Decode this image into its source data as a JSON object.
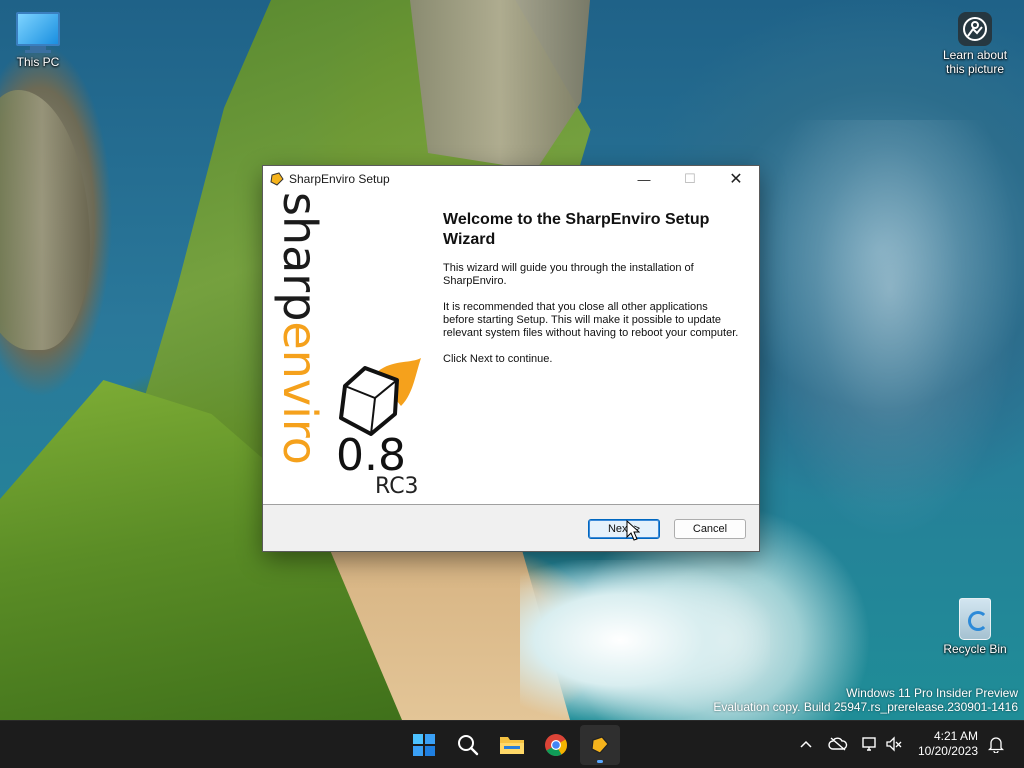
{
  "desktop": {
    "icons": [
      {
        "label": "This PC"
      },
      {
        "label": "Learn about this picture"
      },
      {
        "label": "Recycle Bin"
      }
    ],
    "watermark": {
      "line1": "Windows 11 Pro Insider Preview",
      "line2": "Evaluation copy. Build 25947.rs_prerelease.230901-1416"
    }
  },
  "dialog": {
    "title": "SharpEnviro Setup",
    "window_controls": {
      "minimize": "—",
      "maximize": "☐",
      "close": "✕"
    },
    "banner": {
      "word_dark": "sharp",
      "word_accent": "enviro",
      "version": "0.8",
      "release": "RC3"
    },
    "heading": "Welcome to the SharpEnviro Setup Wizard",
    "paragraphs": [
      "This wizard will guide you through the installation of SharpEnviro.",
      "It is recommended that you close all other applications before starting Setup. This will make it possible to update relevant system files without having to reboot your computer.",
      "Click Next to continue."
    ],
    "buttons": {
      "next": "Next >",
      "cancel": "Cancel"
    }
  },
  "taskbar": {
    "apps": [
      {
        "icon": "start-windows-icon"
      },
      {
        "icon": "search-icon"
      },
      {
        "icon": "file-explorer-icon"
      },
      {
        "icon": "chrome-icon"
      },
      {
        "icon": "sharpenviro-setup-icon",
        "active": true
      }
    ],
    "tray": {
      "time": "4:21 AM",
      "date": "10/20/2023"
    }
  },
  "colors": {
    "accent": "#0067c0",
    "logo_orange": "#f5a11c",
    "taskbar": "#1c1c1c",
    "dialog_footer": "#f0f0f0"
  }
}
